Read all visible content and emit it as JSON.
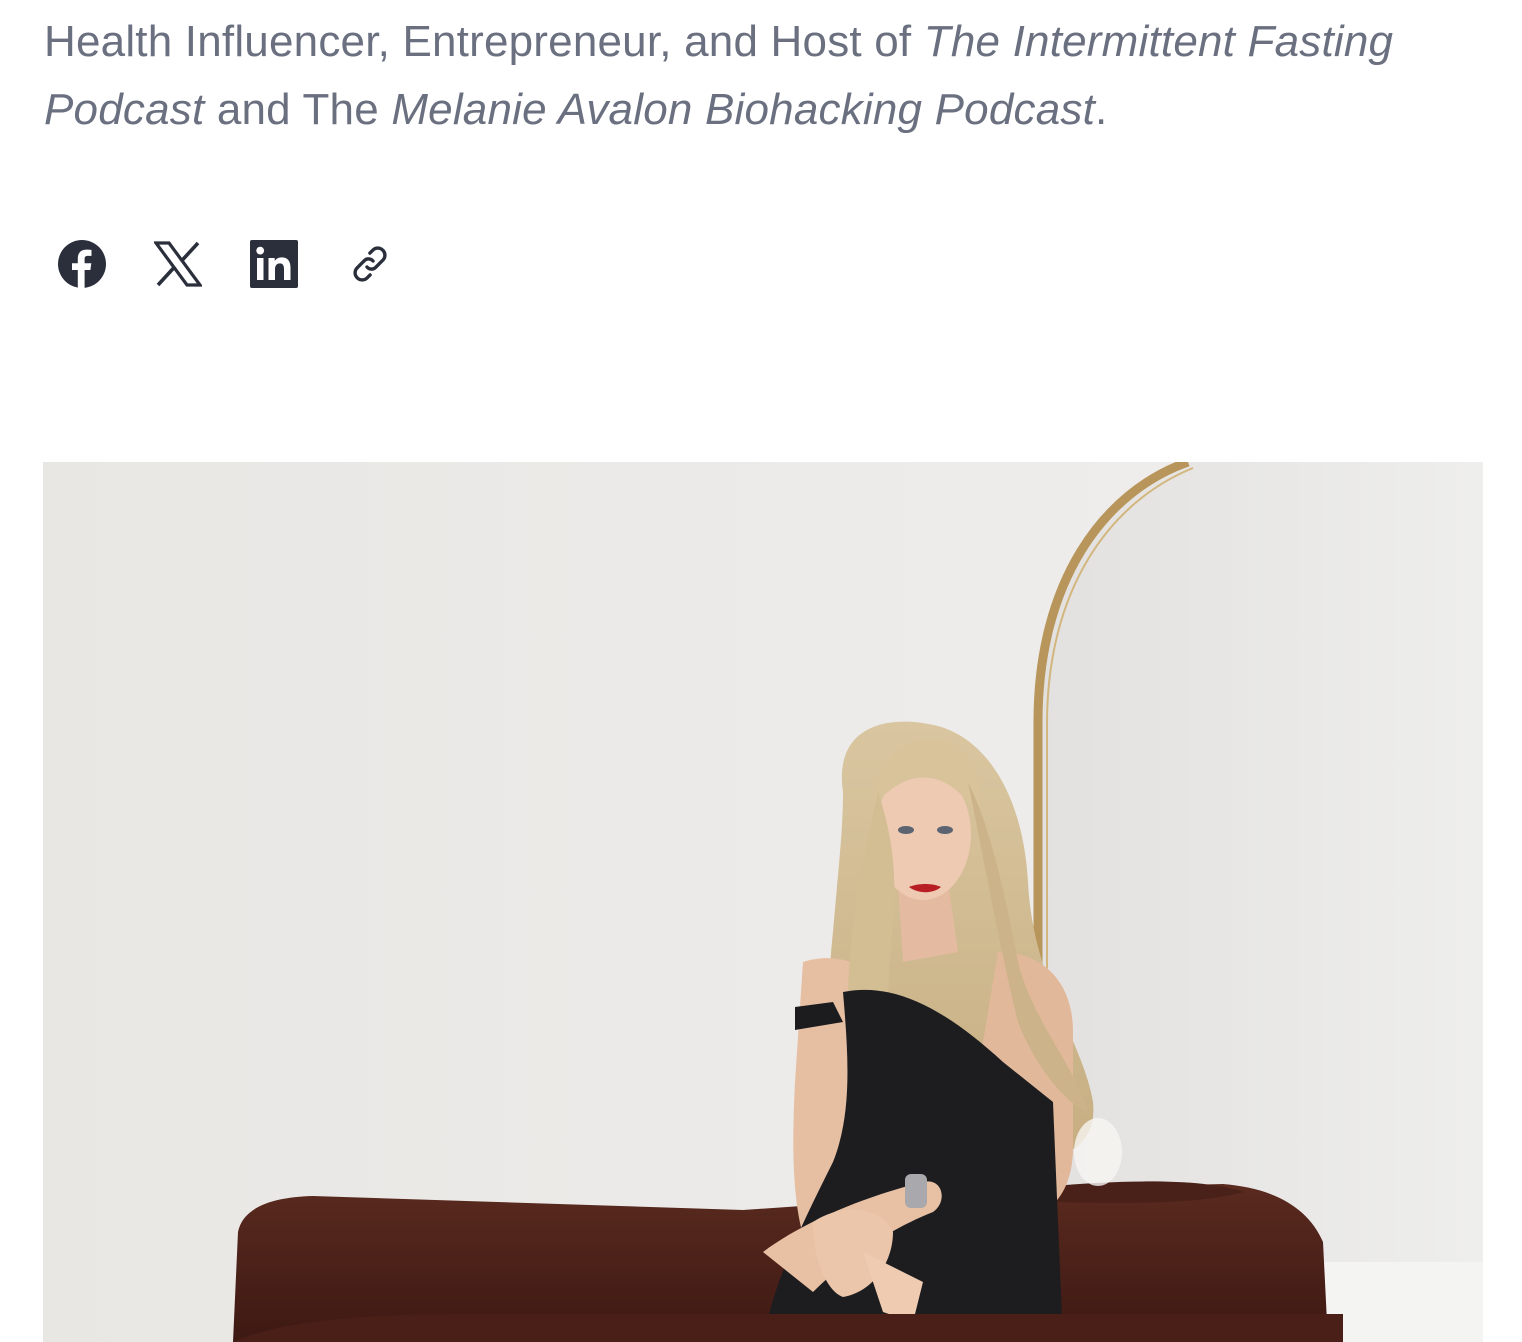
{
  "bio": {
    "prefix": "Health Influencer, Entrepreneur, and Host of ",
    "podcast_one": "The Intermittent Fasting Podcast",
    "middle": " and The ",
    "podcast_two": "Melanie Avalon Biohacking Podcast",
    "suffix": "."
  },
  "share": {
    "icons": [
      "facebook-icon",
      "x-icon",
      "linkedin-icon",
      "link-icon"
    ]
  },
  "colors": {
    "text": "#6b7080",
    "icon": "#2b2f3b",
    "background": "#ffffff"
  }
}
